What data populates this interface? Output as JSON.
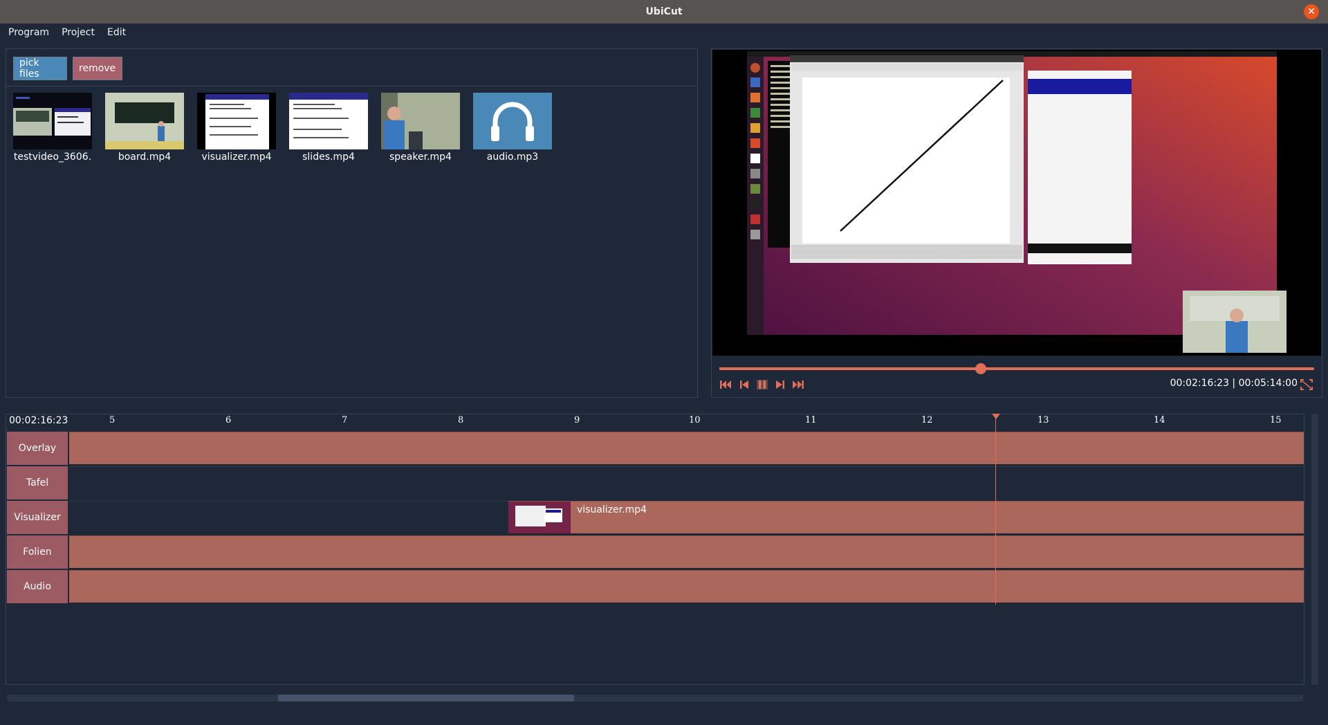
{
  "window": {
    "title": "UbiCut"
  },
  "menu": [
    "Program",
    "Project",
    "Edit"
  ],
  "media": {
    "pick_label": "pick files",
    "remove_label": "remove",
    "items": [
      {
        "label": "testvideo_3606.",
        "icon": "video-thumbnail"
      },
      {
        "label": "board.mp4",
        "icon": "video-thumbnail"
      },
      {
        "label": "visualizer.mp4",
        "icon": "video-thumbnail"
      },
      {
        "label": "slides.mp4",
        "icon": "video-thumbnail"
      },
      {
        "label": "speaker.mp4",
        "icon": "video-thumbnail"
      },
      {
        "label": "audio.mp3",
        "icon": "headphones-icon"
      }
    ]
  },
  "player": {
    "current_time": "00:02:16:23",
    "duration": "00:05:14:00",
    "time_display": "00:02:16:23 | 00:05:14:00",
    "progress": 0.44
  },
  "timeline": {
    "timecode": "00:02:16:23",
    "ticks": [
      "5",
      "6",
      "7",
      "8",
      "9",
      "10",
      "11",
      "12",
      "13",
      "14",
      "15"
    ],
    "tracks": [
      {
        "label": "Overlay"
      },
      {
        "label": "Tafel"
      },
      {
        "label": "Visualizer",
        "clip_label": "visualizer.mp4"
      },
      {
        "label": "Folien"
      },
      {
        "label": "Audio"
      }
    ]
  },
  "colors": {
    "accent": "#e06e58",
    "clip": "#ac675d",
    "track_label": "#9c5a62",
    "pick_button": "#4a88b8",
    "remove_button": "#a8606a"
  }
}
